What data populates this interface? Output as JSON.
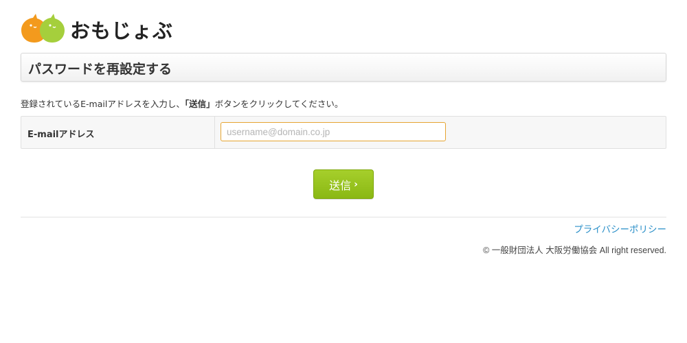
{
  "logo": {
    "icon": "two-speech-bubbles-logo",
    "text": "おもじょぶ",
    "colors": {
      "left_bubble": "#f39a1d",
      "right_bubble": "#a5cf3c"
    }
  },
  "page": {
    "title": "パスワードを再設定する",
    "instruction_before": "登録されているE-mailアドレスを入力し、",
    "instruction_emphasis": "「送信」",
    "instruction_after": "ボタンをクリックしてください。"
  },
  "form": {
    "email_label": "E-mailアドレス",
    "email_value": "",
    "email_placeholder": "username@domain.co.jp",
    "submit_label": "送信",
    "submit_icon": "chevron-right-icon"
  },
  "footer": {
    "privacy_link": "プライバシーポリシー",
    "copyright": "© 一般財団法人 大阪労働協会 All right reserved."
  },
  "colors": {
    "accent_green": "#96c31e",
    "link_blue": "#2a8fc8",
    "input_border": "#e6a430"
  }
}
